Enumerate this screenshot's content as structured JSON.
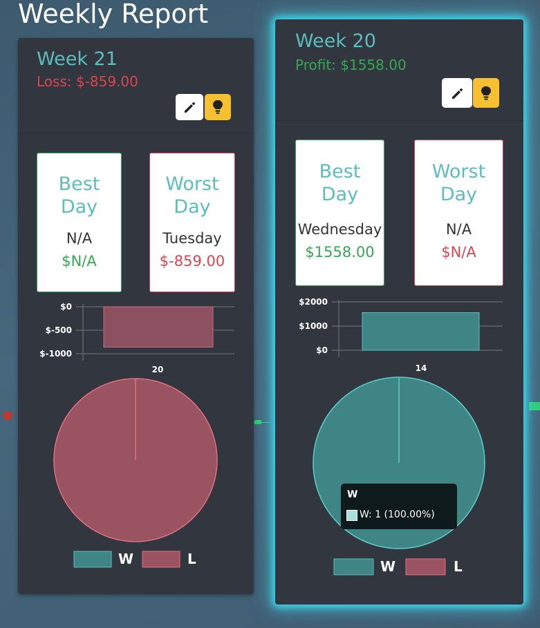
{
  "page": {
    "title": "Weekly Report"
  },
  "colors": {
    "accent_teal": "#5bbdbd",
    "loss_red": "#d9454f",
    "profit_green": "#34a853",
    "edit_button": "#ffffff",
    "tip_button": "#f6c032",
    "win_fill": "#3f8585",
    "loss_fill": "#9a5360",
    "highlight_glow": "#3fd6ea"
  },
  "cards": [
    {
      "week_title": "Week 21",
      "result_label": "Loss: $-859.00",
      "buttons": {
        "edit_icon": "pencil-icon",
        "tip_icon": "lightbulb-icon"
      },
      "best_day": {
        "heading_1": "Best",
        "heading_2": "Day",
        "day": "N/A",
        "value": "$N/A"
      },
      "worst_day": {
        "heading_1": "Worst",
        "heading_2": "Day",
        "day": "Tuesday",
        "value": "$-859.00"
      },
      "bar_axis_labels": [
        "$0",
        "$-500",
        "$-1000"
      ],
      "pie_label": "20",
      "legend": [
        "W",
        "L"
      ]
    },
    {
      "week_title": "Week 20",
      "result_label": "Profit: $1558.00",
      "buttons": {
        "edit_icon": "pencil-icon",
        "tip_icon": "lightbulb-icon"
      },
      "best_day": {
        "heading_1": "Best",
        "heading_2": "Day",
        "day": "Wednesday",
        "value": "$1558.00"
      },
      "worst_day": {
        "heading_1": "Worst",
        "heading_2": "Day",
        "day": "N/A",
        "value": "$N/A"
      },
      "bar_axis_labels": [
        "$2000",
        "$1000",
        "$0"
      ],
      "pie_label": "14",
      "legend": [
        "W",
        "L"
      ],
      "tooltip": {
        "title": "W",
        "text": "W: 1 (100.00%)"
      }
    }
  ],
  "chart_data": [
    {
      "type": "bar",
      "week": "Week 21",
      "values": [
        -859
      ],
      "ylim": [
        -1000,
        0
      ],
      "yticks": [
        "$0",
        "$-500",
        "$-1000"
      ]
    },
    {
      "type": "pie",
      "week": "Week 21",
      "series": [
        {
          "name": "W",
          "value": 0
        },
        {
          "name": "L",
          "value": 1
        }
      ],
      "label": "20"
    },
    {
      "type": "bar",
      "week": "Week 20",
      "values": [
        1558
      ],
      "ylim": [
        0,
        2000
      ],
      "yticks": [
        "$2000",
        "$1000",
        "$0"
      ]
    },
    {
      "type": "pie",
      "week": "Week 20",
      "series": [
        {
          "name": "W",
          "value": 1
        },
        {
          "name": "L",
          "value": 0
        }
      ],
      "label": "14"
    }
  ]
}
